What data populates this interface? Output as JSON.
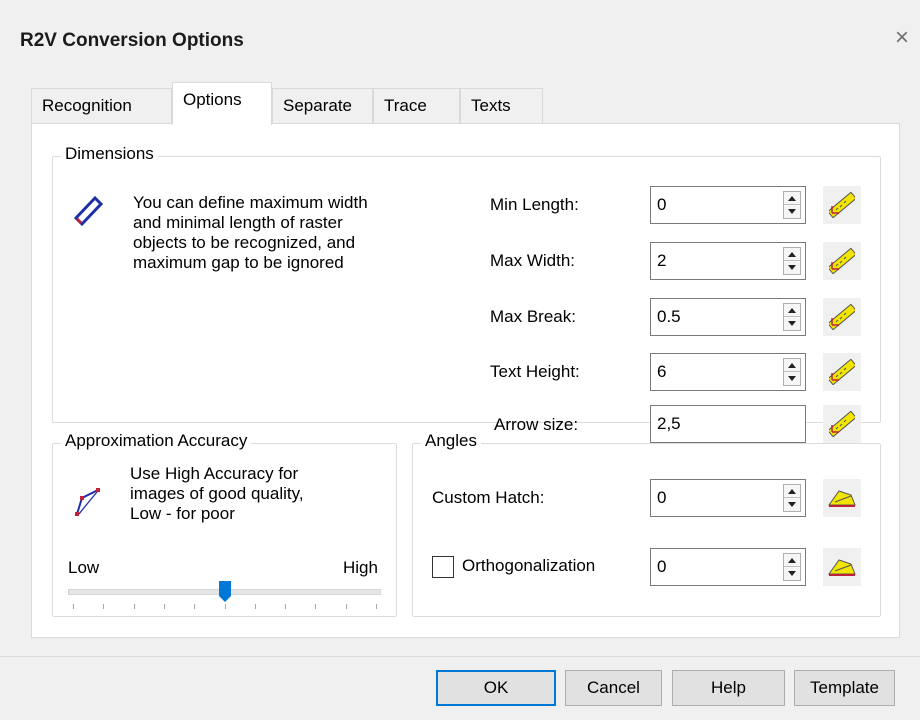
{
  "dialog": {
    "title": "R2V Conversion Options",
    "close_glyph": "×"
  },
  "tabs": [
    {
      "label": "Recognition",
      "active": false
    },
    {
      "label": "Options",
      "active": true
    },
    {
      "label": "Separate",
      "active": false
    },
    {
      "label": "Trace",
      "active": false
    },
    {
      "label": "Texts",
      "active": false
    }
  ],
  "dimensions": {
    "legend": "Dimensions",
    "icon": "line-segment-icon",
    "description": "You can define maximum width\nand minimal length of raster\nobjects to be recognized, and\nmaximum gap to be ignored",
    "fields": [
      {
        "label": "Min Length:",
        "value": "0",
        "spinner": true,
        "button_icon": "ruler-icon"
      },
      {
        "label": "Max Width:",
        "value": "2",
        "spinner": true,
        "button_icon": "ruler-icon"
      },
      {
        "label": "Max Break:",
        "value": "0.5",
        "spinner": true,
        "button_icon": "ruler-icon"
      },
      {
        "label": "Text Height:",
        "value": "6",
        "spinner": true,
        "button_icon": "ruler-icon"
      },
      {
        "label": "Arrow size:",
        "value": "2,5",
        "spinner": false,
        "button_icon": "ruler-icon"
      }
    ]
  },
  "accuracy": {
    "legend": "Approximation Accuracy",
    "icon": "polyline-icon",
    "description": "Use High Accuracy  for\nimages of good quality,\nLow - for poor",
    "low_label": "Low",
    "high_label": "High",
    "slider_value": 0.5,
    "tick_count": 11
  },
  "angles": {
    "legend": "Angles",
    "custom_hatch": {
      "label": "Custom Hatch:",
      "value": "0",
      "button_icon": "protractor-icon"
    },
    "orthogonalization": {
      "label": "Orthogonalization",
      "checked": false,
      "value": "0",
      "button_icon": "protractor-icon"
    }
  },
  "buttons": {
    "ok": "OK",
    "cancel": "Cancel",
    "help": "Help",
    "template": "Template"
  },
  "colors": {
    "accent": "#0078d7",
    "icon_blue": "#1f2fa8",
    "icon_red": "#c0203a",
    "ruler_yellow": "#f2e600"
  }
}
